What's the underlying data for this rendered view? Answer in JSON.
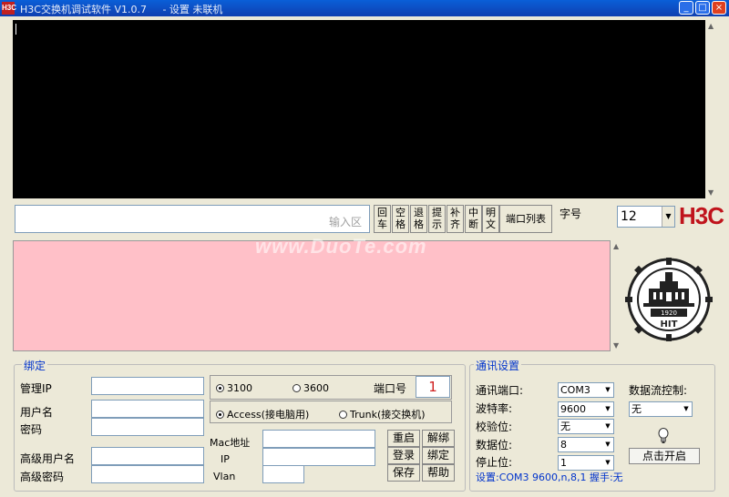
{
  "window": {
    "title": "H3C交换机调试软件 V1.0.7",
    "title_extra": "- 设置 未联机",
    "minimize": "_",
    "maximize": "□",
    "close": "×",
    "icon_text": "H3C"
  },
  "console": {
    "input_hint": "输入区",
    "buttons": [
      {
        "l1": "回",
        "l2": "车"
      },
      {
        "l1": "空",
        "l2": "格"
      },
      {
        "l1": "退",
        "l2": "格"
      },
      {
        "l1": "提",
        "l2": "示"
      },
      {
        "l1": "补",
        "l2": "齐"
      },
      {
        "l1": "中",
        "l2": "断"
      },
      {
        "l1": "明",
        "l2": "文"
      }
    ],
    "ports_list": "端口列表",
    "font_label": "字号",
    "font_size": "12",
    "brand": "H3C"
  },
  "watermark": "www.DuoTe.com",
  "emblem": {
    "year": "1920",
    "abbr": "HIT"
  },
  "binding": {
    "title": "绑定",
    "manage_ip": "管理IP",
    "username": "用户名",
    "password": "密码",
    "adv_user": "高级用户名",
    "adv_password": "高级密码",
    "radio_3100": "3100",
    "radio_3600": "3600",
    "port_label": "端口号",
    "port_value": "1",
    "access": "Access(接电脑用)",
    "trunk": "Trunk(接交换机)",
    "mac": "Mac地址",
    "ip": "IP",
    "vlan": "Vlan",
    "restart": "重启",
    "unbind": "解绑",
    "login": "登录",
    "bind": "绑定",
    "save": "保存",
    "help": "帮助"
  },
  "comm": {
    "title": "通讯设置",
    "port_label": "通讯端口:",
    "port_value": "COM3",
    "baud_label": "波特率:",
    "baud_value": "9600",
    "parity_label": "校验位:",
    "parity_value": "无",
    "databits_label": "数据位:",
    "databits_value": "8",
    "stopbits_label": "停止位:",
    "stopbits_value": "1",
    "flow_label": "数据流控制:",
    "flow_value": "无",
    "start": "点击开启",
    "settings": "设置:COM3 9600,n,8,1 握手:无"
  }
}
